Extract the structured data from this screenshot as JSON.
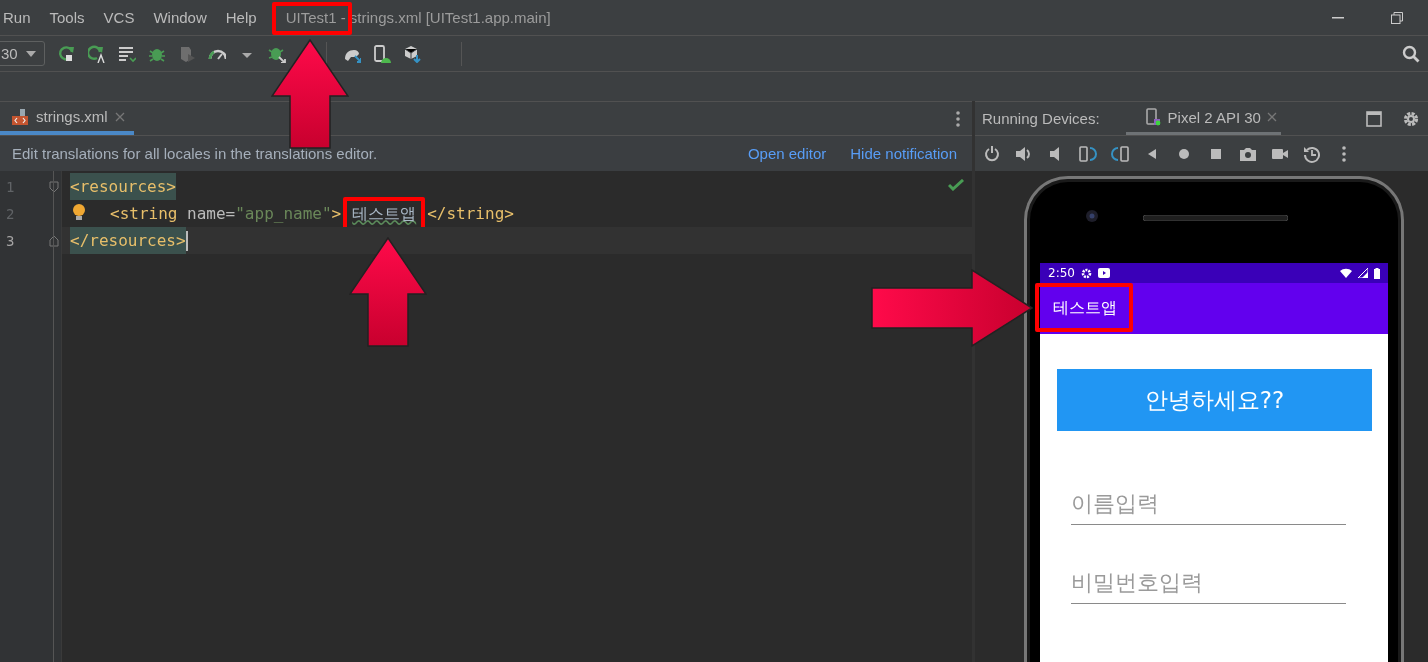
{
  "menu": [
    {
      "label": "Run"
    },
    {
      "label": "Tools"
    },
    {
      "label": "VCS"
    },
    {
      "label": "Window"
    },
    {
      "label": "Help"
    }
  ],
  "window": {
    "title": "UITest1 - strings.xml [UITest1.app.main]"
  },
  "toolbar": {
    "device_selector": "30"
  },
  "editor": {
    "tabs": [
      {
        "label": "strings.xml",
        "selected": true
      }
    ],
    "notification": {
      "message": "Edit translations for all locales in the translations editor.",
      "actions": [
        "Open editor",
        "Hide notification"
      ]
    },
    "lines": [
      {
        "number": "1",
        "current": false,
        "tokens": [
          {
            "kind": "tag",
            "text": "<resources>",
            "matched": true,
            "boxed": false
          }
        ]
      },
      {
        "number": "2",
        "current": false,
        "tokens": [
          {
            "kind": "tag",
            "text": "<string",
            "matched": false,
            "boxed": false
          },
          {
            "kind": "attr",
            "text": " name=",
            "matched": false,
            "boxed": false
          },
          {
            "kind": "value",
            "text": "\"app_name\"",
            "matched": false,
            "boxed": false
          },
          {
            "kind": "tag",
            "text": ">",
            "matched": false,
            "boxed": false
          },
          {
            "kind": "text",
            "text": "테스트앱",
            "matched": false,
            "boxed": true
          },
          {
            "kind": "tag",
            "text": "</string>",
            "matched": false,
            "boxed": false
          }
        ]
      },
      {
        "number": "3",
        "current": true,
        "tokens": [
          {
            "kind": "tag",
            "text": "</resources>",
            "matched": true,
            "boxed": false
          }
        ]
      }
    ]
  },
  "devices_panel": {
    "title": "Running Devices:",
    "tabs": [
      {
        "label": "Pixel 2 API 30",
        "selected": true
      }
    ]
  },
  "phone": {
    "status_time": "2:50",
    "app_title": "테스트앱",
    "button": "안녕하세요??",
    "fields": [
      {
        "placeholder": "이름입력"
      },
      {
        "placeholder": "비밀번호입력"
      }
    ]
  }
}
